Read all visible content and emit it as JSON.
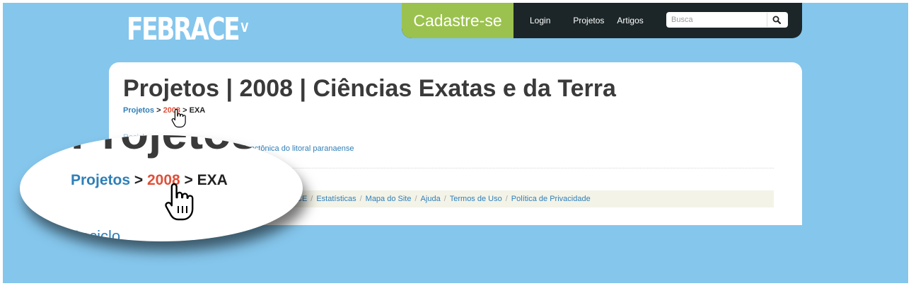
{
  "header": {
    "logo_text": "FEBRACE",
    "logo_sup": "V",
    "signup_label": "Cadastre-se",
    "nav": [
      "Login",
      "Projetos",
      "Artigos"
    ],
    "search_placeholder": "Busca"
  },
  "page": {
    "title": "Projetos | 2008 | Ciências Exatas e da Terra",
    "breadcrumb": [
      "Projetos",
      "2008",
      "EXA"
    ],
    "breadcrumb_sep": ">",
    "category_link": "Reciclo",
    "project_link": "planctônica do litoral paranaense"
  },
  "footer": {
    "fragment": "CE",
    "links": [
      "Estatísticas",
      "Mapa do Site",
      "Ajuda",
      "Termos de Uso",
      "Política de Privacidade"
    ],
    "separator": "/"
  },
  "magnifier": {
    "title_fragment": "Projetos",
    "breadcrumb": [
      "Projetos",
      "2008",
      "EXA"
    ],
    "category_fragment": "Reciclo"
  },
  "colors": {
    "background": "#85c6ec",
    "topbar": "#1c2628",
    "signup": "#9bc24e",
    "link": "#2f7fb8",
    "active_crumb": "#e0503a"
  }
}
